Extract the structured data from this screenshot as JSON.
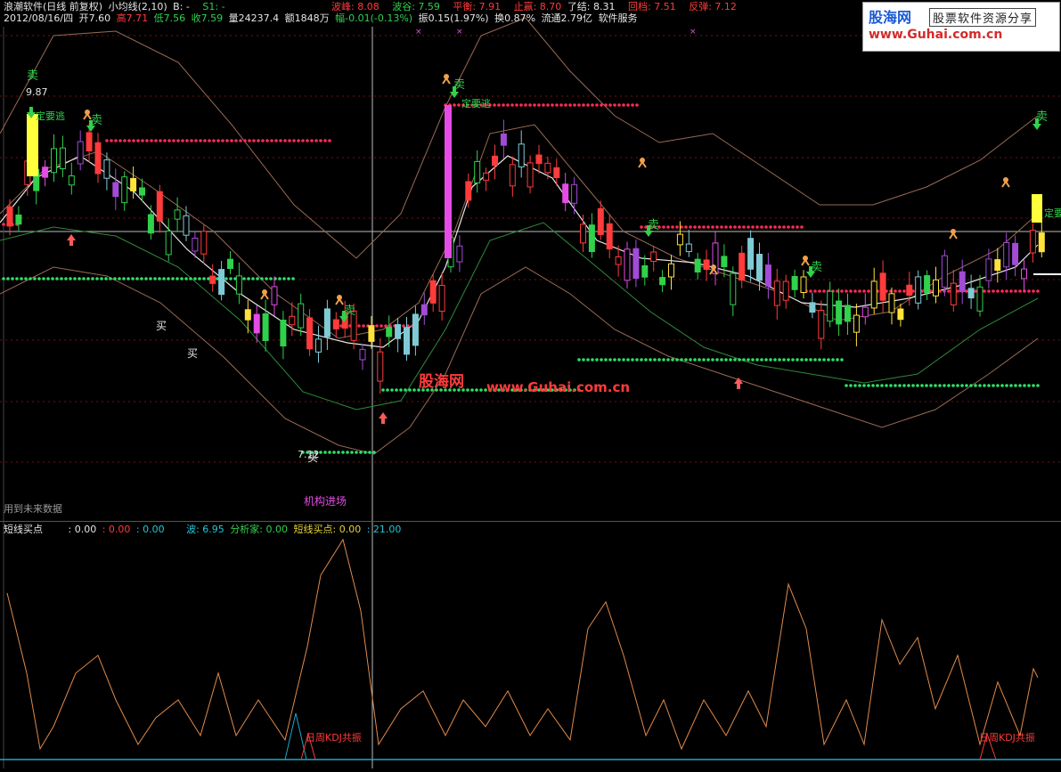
{
  "header": {
    "app": "浪潮软件(日线 前复权)",
    "indicator": "小均线(2,10)",
    "b_label": "B: -",
    "s1_label": "S1: -",
    "wave_peak": "波峰: 8.08",
    "wave_valley": "波谷: 7.59",
    "balance": "平衡: 7.91",
    "resist": "止赢: 8.70",
    "close_out": "了结: 8.31",
    "fallback": "回档: 7.51",
    "rebound": "反弹: 7.12"
  },
  "quote": {
    "date": "2012/08/16/四",
    "open": "开7.60",
    "high": "高7.71",
    "low": "低7.56",
    "close": "收7.59",
    "volume": "量24237.4",
    "amount": "额1848万",
    "change": "幅-0.01(-0.13%)",
    "amplitude": "振0.15(1.97%)",
    "turnover": "换0.87%",
    "float": "流通2.79亿",
    "sector": "软件服务"
  },
  "brand": {
    "name": "股海网",
    "slogan": "股票软件资源分享",
    "url": "www.Guhai.com.cn"
  },
  "watermark": {
    "name": "股海网",
    "url": "www.Guhai.com.cn"
  },
  "annotations": {
    "sell": "卖",
    "buy": "买",
    "must_escape": "定要逃",
    "price_peak": "9.87",
    "institution_entry": "机构进场",
    "future_data": "用到未来数据",
    "price_low": "7.12",
    "must_escape_right": "定要"
  },
  "sub": {
    "title": "短线买点",
    "v1": ": 0.00",
    "v2": ": 0.00",
    "v3": ": 0.00",
    "wave": "波: 6.95",
    "analyst": "分析家: 0.00",
    "title2": "短线买点: 0.00",
    "v4": ": 21.00",
    "resonance": "日周KDJ共振"
  },
  "colors": {
    "bg": "#000000",
    "up": "#ff3b3b",
    "down": "#30d14b",
    "ma": "#e6e6e6",
    "band": "#c47a5a",
    "red_dots": "#ff2a55",
    "green_dots": "#2ee06b",
    "kdj": "#e08a4a"
  }
}
